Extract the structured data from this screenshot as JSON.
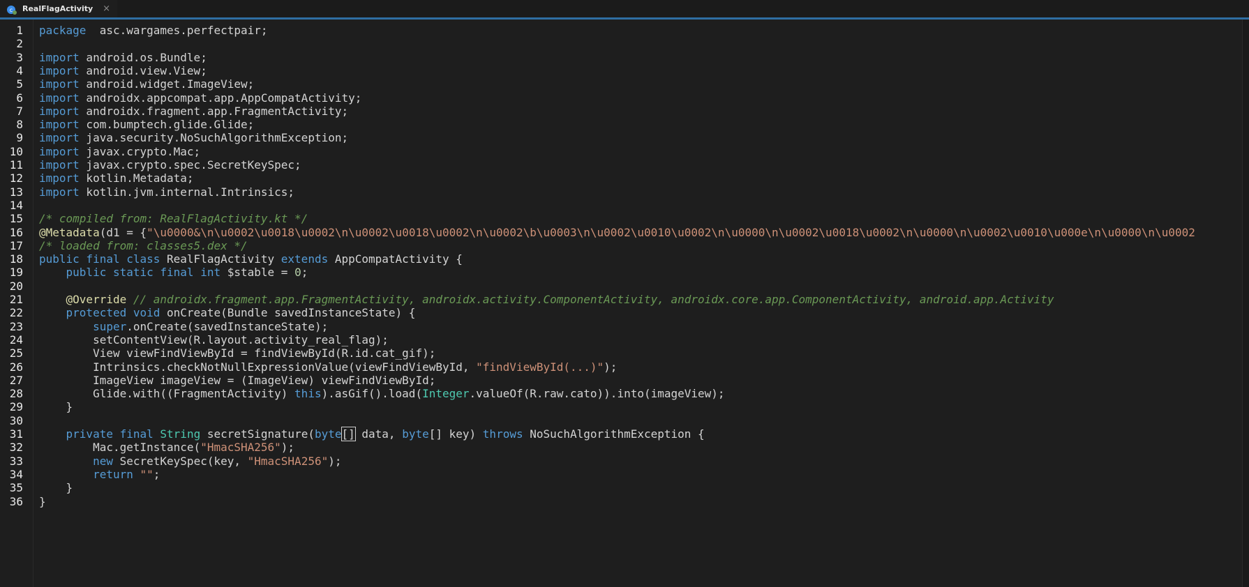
{
  "tab": {
    "title": "RealFlagActivity",
    "close_glyph": "×",
    "icon": "kotlin-class-icon"
  },
  "editor": {
    "line_numbers": [
      "1",
      "2",
      "3",
      "4",
      "5",
      "6",
      "7",
      "8",
      "9",
      "10",
      "11",
      "12",
      "13",
      "14",
      "15",
      "16",
      "17",
      "18",
      "19",
      "20",
      "21",
      "22",
      "23",
      "24",
      "25",
      "26",
      "27",
      "28",
      "29",
      "30",
      "31",
      "32",
      "33",
      "34",
      "35",
      "36"
    ],
    "lines": [
      [
        [
          "kw",
          "package"
        ],
        [
          "",
          "  asc.wargames.perfectpair;"
        ]
      ],
      [],
      [
        [
          "kw",
          "import"
        ],
        [
          "",
          " android.os.Bundle;"
        ]
      ],
      [
        [
          "kw",
          "import"
        ],
        [
          "",
          " android.view.View;"
        ]
      ],
      [
        [
          "kw",
          "import"
        ],
        [
          "",
          " android.widget.ImageView;"
        ]
      ],
      [
        [
          "kw",
          "import"
        ],
        [
          "",
          " androidx.appcompat.app.AppCompatActivity;"
        ]
      ],
      [
        [
          "kw",
          "import"
        ],
        [
          "",
          " androidx.fragment.app.FragmentActivity;"
        ]
      ],
      [
        [
          "kw",
          "import"
        ],
        [
          "",
          " com.bumptech.glide.Glide;"
        ]
      ],
      [
        [
          "kw",
          "import"
        ],
        [
          "",
          " java.security.NoSuchAlgorithmException;"
        ]
      ],
      [
        [
          "kw",
          "import"
        ],
        [
          "",
          " javax.crypto.Mac;"
        ]
      ],
      [
        [
          "kw",
          "import"
        ],
        [
          "",
          " javax.crypto.spec.SecretKeySpec;"
        ]
      ],
      [
        [
          "kw",
          "import"
        ],
        [
          "",
          " kotlin.Metadata;"
        ]
      ],
      [
        [
          "kw",
          "import"
        ],
        [
          "",
          " kotlin.jvm.internal.Intrinsics;"
        ]
      ],
      [],
      [
        [
          "cm",
          "/* compiled from: RealFlagActivity.kt */"
        ]
      ],
      [
        [
          "an",
          "@Metadata"
        ],
        [
          "",
          "(d1 = {"
        ],
        [
          "str",
          "\"\\u0000&\\n\\u0002\\u0018\\u0002\\n\\u0002\\u0018\\u0002\\n\\u0002\\b\\u0003\\n\\u0002\\u0010\\u0002\\n\\u0000\\n\\u0002\\u0018\\u0002\\n\\u0000\\n\\u0002\\u0010\\u000e\\n\\u0000\\n\\u0002"
        ]
      ],
      [
        [
          "cm",
          "/* loaded from: classes5.dex */"
        ]
      ],
      [
        [
          "kw",
          "public final class"
        ],
        [
          "",
          " RealFlagActivity "
        ],
        [
          "kw",
          "extends"
        ],
        [
          "",
          " AppCompatActivity {"
        ]
      ],
      [
        [
          "",
          "    "
        ],
        [
          "kw",
          "public static final int"
        ],
        [
          "",
          " $stable = "
        ],
        [
          "num",
          "0"
        ],
        [
          "",
          ";"
        ]
      ],
      [],
      [
        [
          "",
          "    "
        ],
        [
          "an",
          "@Override"
        ],
        [
          "cm",
          " // androidx.fragment.app.FragmentActivity, androidx.activity.ComponentActivity, androidx.core.app.ComponentActivity, android.app.Activity"
        ]
      ],
      [
        [
          "",
          "    "
        ],
        [
          "kw",
          "protected void"
        ],
        [
          "",
          " onCreate(Bundle savedInstanceState) {"
        ]
      ],
      [
        [
          "",
          "        "
        ],
        [
          "kw",
          "super"
        ],
        [
          "",
          ".onCreate(savedInstanceState);"
        ]
      ],
      [
        [
          "",
          "        setContentView(R.layout.activity_real_flag);"
        ]
      ],
      [
        [
          "",
          "        View viewFindViewById = findViewById(R.id.cat_gif);"
        ]
      ],
      [
        [
          "",
          "        Intrinsics.checkNotNullExpressionValue(viewFindViewById, "
        ],
        [
          "str",
          "\"findViewById(...)\""
        ],
        [
          "",
          ");"
        ]
      ],
      [
        [
          "",
          "        ImageView imageView = (ImageView) viewFindViewById;"
        ]
      ],
      [
        [
          "",
          "        Glide.with((FragmentActivity) "
        ],
        [
          "kw",
          "this"
        ],
        [
          "",
          ").asGif().load("
        ],
        [
          "ty",
          "Integer"
        ],
        [
          "",
          ".valueOf(R.raw.cato)).into(imageView);"
        ]
      ],
      [
        [
          "",
          "    }"
        ]
      ],
      [],
      [
        [
          "",
          "    "
        ],
        [
          "kw",
          "private final"
        ],
        [
          "",
          " "
        ],
        [
          "ty",
          "String"
        ],
        [
          "",
          " secretSignature("
        ],
        [
          "kw",
          "byte"
        ],
        [
          "cur",
          "[]"
        ],
        [
          "",
          " data, "
        ],
        [
          "kw",
          "byte"
        ],
        [
          "",
          "[] key) "
        ],
        [
          "kw",
          "throws"
        ],
        [
          "",
          " NoSuchAlgorithmException {"
        ]
      ],
      [
        [
          "",
          "        Mac.getInstance("
        ],
        [
          "str",
          "\"HmacSHA256\""
        ],
        [
          "",
          ");"
        ]
      ],
      [
        [
          "",
          "        "
        ],
        [
          "kw",
          "new"
        ],
        [
          "",
          " SecretKeySpec(key, "
        ],
        [
          "str",
          "\"HmacSHA256\""
        ],
        [
          "",
          ");"
        ]
      ],
      [
        [
          "",
          "        "
        ],
        [
          "kw",
          "return"
        ],
        [
          "",
          " "
        ],
        [
          "str",
          "\"\""
        ],
        [
          "",
          ";"
        ]
      ],
      [
        [
          "",
          "    }"
        ]
      ],
      [
        [
          "",
          "}"
        ]
      ]
    ]
  },
  "colors": {
    "accent": "#2f6ea3",
    "keyword": "#569cd6",
    "string": "#ce9178",
    "comment": "#6a9955",
    "number": "#b5cea8",
    "annotation": "#dcdcaa"
  }
}
